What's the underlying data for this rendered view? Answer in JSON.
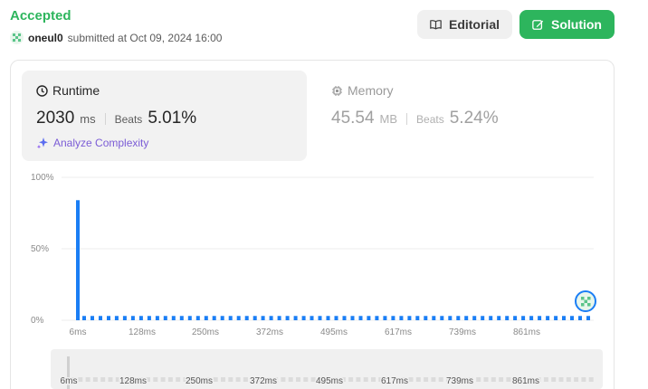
{
  "header": {
    "status": "Accepted",
    "username": "oneul0",
    "submitted_text": "submitted at Oct 09, 2024 16:00"
  },
  "buttons": {
    "editorial": "Editorial",
    "solution": "Solution"
  },
  "runtime": {
    "label": "Runtime",
    "value": "2030",
    "unit": "ms",
    "beats_label": "Beats",
    "beats_value": "5.01%",
    "analyze_label": "Analyze Complexity"
  },
  "memory": {
    "label": "Memory",
    "value": "45.54",
    "unit": "MB",
    "beats_label": "Beats",
    "beats_value": "5.24%"
  },
  "colors": {
    "accent_green": "#2db55d",
    "bar_blue": "#1a7ef5",
    "analyze_purple": "#7b5cd6"
  },
  "chart_data": {
    "type": "bar",
    "yticks": [
      "100%",
      "50%",
      "0%"
    ],
    "ylim": [
      0,
      100
    ],
    "xticks": [
      "6ms",
      "128ms",
      "250ms",
      "372ms",
      "495ms",
      "617ms",
      "739ms",
      "861ms"
    ],
    "first_bar_value": 84,
    "small_bar_value": 3,
    "small_bar_count": 63,
    "marker": "user-position-avatar"
  },
  "brush": {
    "ticks": [
      "6ms",
      "128ms",
      "250ms",
      "372ms",
      "495ms",
      "617ms",
      "739ms",
      "861ms"
    ]
  }
}
